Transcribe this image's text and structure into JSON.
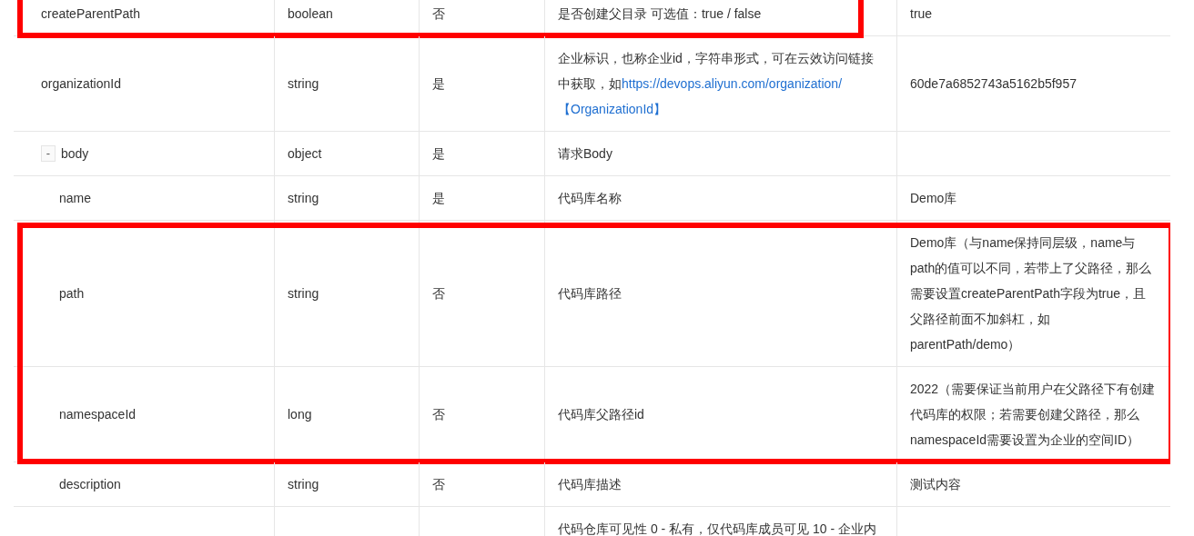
{
  "table": {
    "rows": [
      {
        "name": "createParentPath",
        "type": "boolean",
        "required": "否",
        "description": "是否创建父目录 可选值：true / false",
        "example": "true",
        "highlighted": true,
        "highlight_covers_example": false
      },
      {
        "name": "organizationId",
        "type": "string",
        "required": "是",
        "description": "企业标识，也称企业id，字符串形式，可在云效访问链接中获取，如",
        "description_links": [
          "https://devops.aliyun.com/organization/",
          "【OrganizationId】"
        ],
        "example": "60de7a6852743a5162b5f957"
      },
      {
        "name": "body",
        "toggle": "-",
        "type": "object",
        "required": "是",
        "description": "请求Body",
        "children": [
          {
            "name": "name",
            "type": "string",
            "required": "是",
            "description": "代码库名称",
            "example": "Demo库"
          },
          {
            "name": "path",
            "type": "string",
            "required": "否",
            "description": "代码库路径",
            "example": "Demo库（与name保持同层级，name与path的值可以不同，若带上了父路径，那么需要设置createParentPath字段为true，且父路径前面不加斜杠，如parentPath/demo）",
            "highlighted": true,
            "highlight_covers_example": true
          },
          {
            "name": "namespaceId",
            "type": "long",
            "required": "否",
            "description": "代码库父路径id",
            "example": "2022（需要保证当前用户在父路径下有创建代码库的权限；若需要创建父路径，那么namespaceId需要设置为企业的空间ID）",
            "highlighted": true,
            "highlight_covers_example": true
          },
          {
            "name": "description",
            "type": "string",
            "required": "否",
            "description": "代码库描述",
            "example": "测试内容"
          },
          {
            "description": "代码仓库可见性 0 - 私有，仅代码库成员可见 10 - 企业内"
          }
        ]
      }
    ]
  }
}
